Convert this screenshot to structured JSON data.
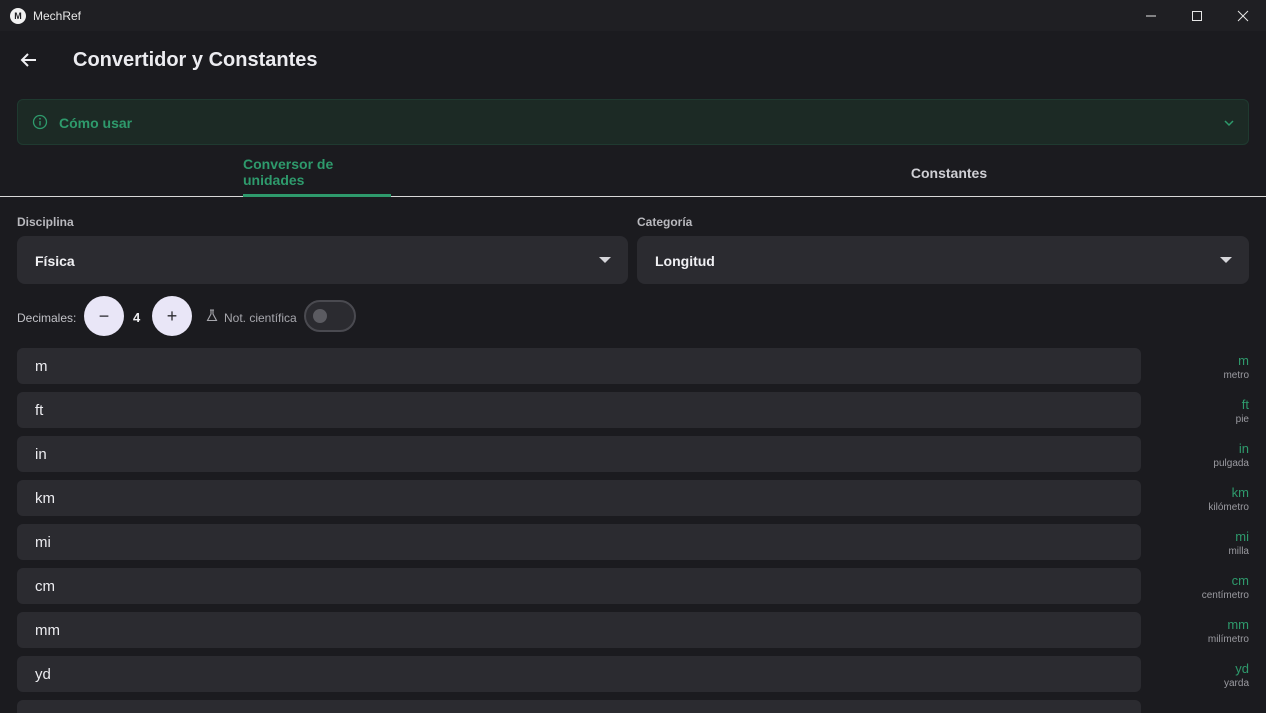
{
  "window": {
    "app_name": "MechRef",
    "logo_letter": "M"
  },
  "header": {
    "title": "Convertidor y Constantes"
  },
  "howto": {
    "label": "Cómo usar"
  },
  "tabs": [
    {
      "label": "Conversor de unidades",
      "active": true
    },
    {
      "label": "Constantes",
      "active": false
    }
  ],
  "filters": {
    "discipline": {
      "label": "Disciplina",
      "value": "Física"
    },
    "category": {
      "label": "Categoría",
      "value": "Longitud"
    }
  },
  "decimals": {
    "label": "Decimales:",
    "value": "4",
    "minus": "−",
    "plus": "+"
  },
  "scientific": {
    "label": "Not. científica",
    "enabled": false
  },
  "units": [
    {
      "placeholder": "m",
      "symbol": "m",
      "name": "metro"
    },
    {
      "placeholder": "ft",
      "symbol": "ft",
      "name": "pie"
    },
    {
      "placeholder": "in",
      "symbol": "in",
      "name": "pulgada"
    },
    {
      "placeholder": "km",
      "symbol": "km",
      "name": "kilómetro"
    },
    {
      "placeholder": "mi",
      "symbol": "mi",
      "name": "milla"
    },
    {
      "placeholder": "cm",
      "symbol": "cm",
      "name": "centímetro"
    },
    {
      "placeholder": "mm",
      "symbol": "mm",
      "name": "milímetro"
    },
    {
      "placeholder": "yd",
      "symbol": "yd",
      "name": "yarda"
    }
  ],
  "colors": {
    "accent": "#2e9a6c",
    "background": "#1b1b1f",
    "surface": "#2b2b30"
  }
}
